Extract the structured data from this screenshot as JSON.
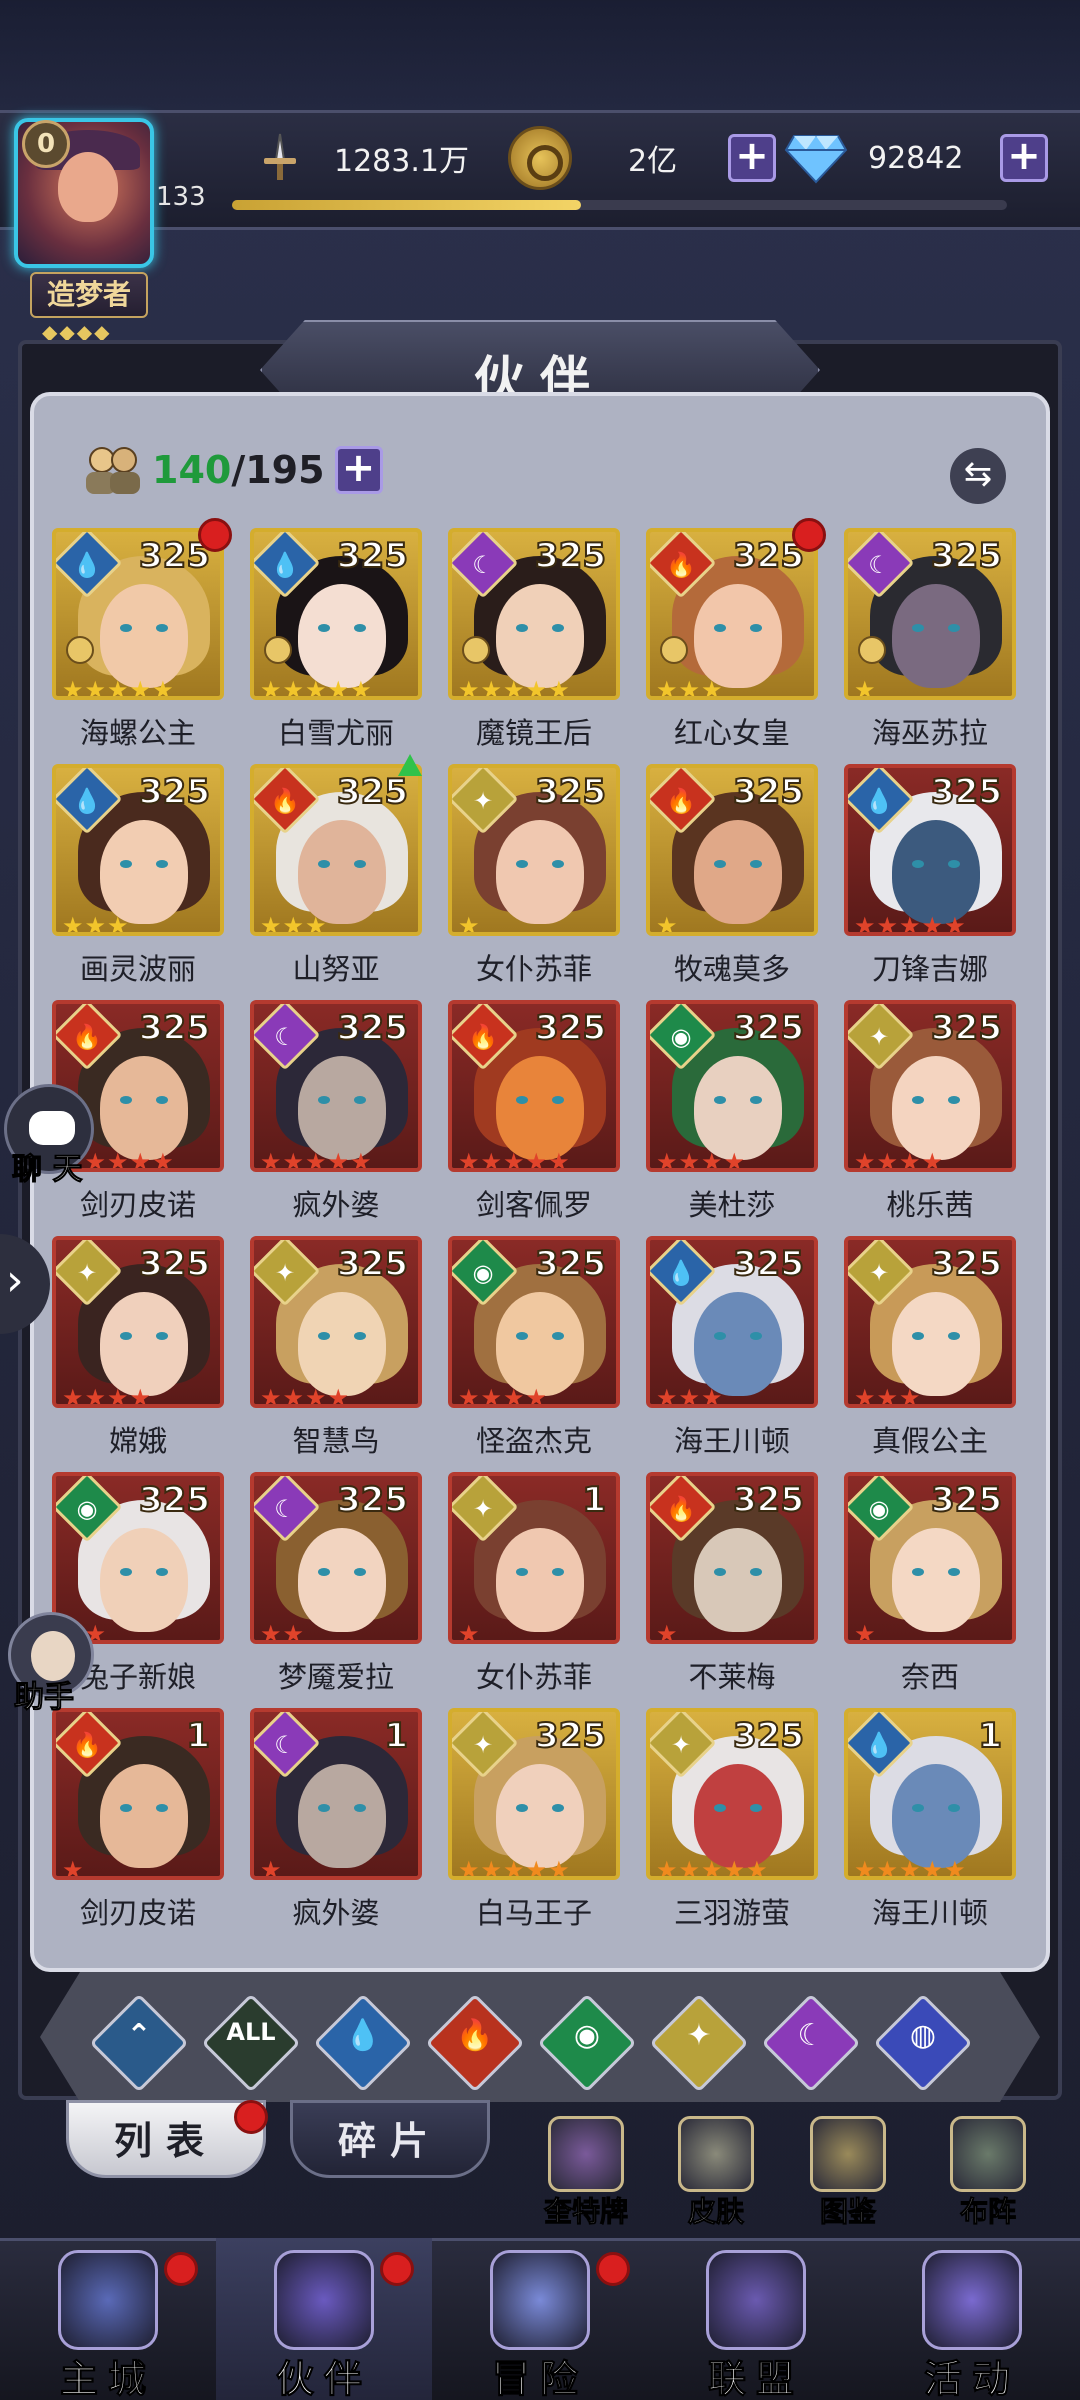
{
  "header": {
    "vip_level": "0",
    "player_level": "133",
    "title_badge": "造梦者",
    "title_stars": "◆◆◆◆",
    "xp_progress": 0.45,
    "power": "1283.1万",
    "gold": "2亿",
    "gems": "92842",
    "plus_label": "+"
  },
  "panel": {
    "title": "伙伴",
    "count_current": "140",
    "count_total": "/195",
    "add_label": "+",
    "swap_label": "⇆"
  },
  "heroes": [
    {
      "name": "海螺公主",
      "level": "325",
      "element": "water",
      "stars": 5,
      "star_color": "gold",
      "frame": "gold",
      "red_dot": true,
      "rank": true,
      "palette": [
        "#d9b35e",
        "#f1c9a8"
      ]
    },
    {
      "name": "白雪尤丽",
      "level": "325",
      "element": "water",
      "stars": 5,
      "star_color": "gold",
      "frame": "gold",
      "red_dot": false,
      "rank": true,
      "palette": [
        "#1a1416",
        "#f4ded2"
      ]
    },
    {
      "name": "魔镜王后",
      "level": "325",
      "element": "arcane",
      "stars": 5,
      "star_color": "gold",
      "frame": "gold",
      "red_dot": false,
      "rank": true,
      "palette": [
        "#2a1d1a",
        "#f0d0b8"
      ]
    },
    {
      "name": "红心女皇",
      "level": "325",
      "element": "fire",
      "stars": 3,
      "star_color": "gold",
      "frame": "gold",
      "red_dot": true,
      "rank": true,
      "palette": [
        "#b46a3a",
        "#f2c6aa"
      ]
    },
    {
      "name": "海巫苏拉",
      "level": "325",
      "element": "arcane",
      "stars": 1,
      "star_color": "gold",
      "frame": "gold",
      "red_dot": false,
      "rank": true,
      "palette": [
        "#2a2a30",
        "#7a6a80"
      ]
    },
    {
      "name": "画灵波丽",
      "level": "325",
      "element": "water",
      "stars": 3,
      "star_color": "gold",
      "frame": "gold",
      "red_dot": false,
      "rank": false,
      "palette": [
        "#4a2a1e",
        "#f2cdb2"
      ]
    },
    {
      "name": "山努亚",
      "level": "325",
      "element": "fire",
      "stars": 3,
      "star_color": "gold",
      "frame": "gold",
      "red_dot": false,
      "rank": false,
      "green_arrow": true,
      "palette": [
        "#e8e4de",
        "#e0b49a"
      ]
    },
    {
      "name": "女仆苏菲",
      "level": "325",
      "element": "light",
      "stars": 1,
      "star_color": "gold",
      "frame": "gold",
      "red_dot": false,
      "rank": false,
      "palette": [
        "#7a4030",
        "#f0c8b0"
      ]
    },
    {
      "name": "牧魂莫多",
      "level": "325",
      "element": "fire",
      "stars": 1,
      "star_color": "gold",
      "frame": "gold",
      "red_dot": false,
      "rank": false,
      "palette": [
        "#5a3420",
        "#e0a888"
      ]
    },
    {
      "name": "刀锋吉娜",
      "level": "325",
      "element": "water",
      "stars": 5,
      "star_color": "red",
      "frame": "red",
      "red_dot": false,
      "rank": false,
      "palette": [
        "#e8e8ec",
        "#3c5a7e"
      ]
    },
    {
      "name": "剑刃皮诺",
      "level": "325",
      "element": "fire",
      "stars": 5,
      "star_color": "red",
      "frame": "red",
      "red_dot": false,
      "rank": false,
      "palette": [
        "#3a2a22",
        "#e6b898"
      ]
    },
    {
      "name": "疯外婆",
      "level": "325",
      "element": "arcane",
      "stars": 5,
      "star_color": "red",
      "frame": "red",
      "red_dot": false,
      "rank": false,
      "palette": [
        "#2c2838",
        "#b8a8a0"
      ]
    },
    {
      "name": "剑客佩罗",
      "level": "325",
      "element": "fire",
      "stars": 5,
      "star_color": "red",
      "frame": "red",
      "red_dot": false,
      "rank": false,
      "palette": [
        "#a03a20",
        "#e8843a"
      ]
    },
    {
      "name": "美杜莎",
      "level": "325",
      "element": "wind",
      "stars": 4,
      "star_color": "red",
      "frame": "red",
      "red_dot": false,
      "rank": false,
      "palette": [
        "#2a6a3a",
        "#e8d0c0"
      ]
    },
    {
      "name": "桃乐茜",
      "level": "325",
      "element": "light",
      "stars": 4,
      "star_color": "red",
      "frame": "red",
      "red_dot": false,
      "rank": false,
      "palette": [
        "#9a5a3a",
        "#f4d4c0"
      ]
    },
    {
      "name": "嫦娥",
      "level": "325",
      "element": "light",
      "stars": 4,
      "star_color": "red",
      "frame": "red",
      "red_dot": false,
      "rank": false,
      "palette": [
        "#3a2420",
        "#f0d0bc"
      ]
    },
    {
      "name": "智慧鸟",
      "level": "325",
      "element": "light",
      "stars": 4,
      "star_color": "red",
      "frame": "red",
      "red_dot": false,
      "rank": false,
      "palette": [
        "#c8a060",
        "#f0d4b4"
      ]
    },
    {
      "name": "怪盗杰克",
      "level": "325",
      "element": "wind",
      "stars": 4,
      "star_color": "red",
      "frame": "red",
      "red_dot": false,
      "rank": false,
      "palette": [
        "#a07040",
        "#f0c8a0"
      ]
    },
    {
      "name": "海王川顿",
      "level": "325",
      "element": "water",
      "stars": 3,
      "star_color": "red",
      "frame": "red",
      "red_dot": false,
      "rank": false,
      "palette": [
        "#dcdce4",
        "#6a8ab8"
      ]
    },
    {
      "name": "真假公主",
      "level": "325",
      "element": "light",
      "stars": 3,
      "star_color": "red",
      "frame": "red",
      "red_dot": false,
      "rank": false,
      "palette": [
        "#c89a58",
        "#f4d8c4"
      ]
    },
    {
      "name": "兔子新娘",
      "level": "325",
      "element": "wind",
      "stars": 2,
      "star_color": "red",
      "frame": "red",
      "red_dot": false,
      "rank": false,
      "palette": [
        "#e8e4e4",
        "#f0d0b8"
      ]
    },
    {
      "name": "梦魇爱拉",
      "level": "325",
      "element": "arcane",
      "stars": 2,
      "star_color": "red",
      "frame": "red",
      "red_dot": false,
      "rank": false,
      "palette": [
        "#8a6030",
        "#f2d4c0"
      ]
    },
    {
      "name": "女仆苏菲",
      "level": "1",
      "element": "light",
      "stars": 1,
      "star_color": "red",
      "frame": "red",
      "red_dot": false,
      "rank": false,
      "palette": [
        "#7a4030",
        "#f0c8b0"
      ]
    },
    {
      "name": "不莱梅",
      "level": "325",
      "element": "fire",
      "stars": 1,
      "star_color": "red",
      "frame": "red",
      "red_dot": false,
      "rank": false,
      "palette": [
        "#5a3a28",
        "#d8c8b8"
      ]
    },
    {
      "name": "奈西",
      "level": "325",
      "element": "wind",
      "stars": 1,
      "star_color": "red",
      "frame": "red",
      "red_dot": false,
      "rank": false,
      "palette": [
        "#c8a060",
        "#f4d8c4"
      ]
    },
    {
      "name": "剑刃皮诺",
      "level": "1",
      "element": "fire",
      "stars": 1,
      "star_color": "red",
      "frame": "red",
      "red_dot": false,
      "rank": false,
      "palette": [
        "#3a2a22",
        "#e6b898"
      ]
    },
    {
      "name": "疯外婆",
      "level": "1",
      "element": "arcane",
      "stars": 1,
      "star_color": "red",
      "frame": "red",
      "red_dot": false,
      "rank": false,
      "palette": [
        "#2c2838",
        "#b8a8a0"
      ]
    },
    {
      "name": "白马王子",
      "level": "325",
      "element": "light",
      "stars": 5,
      "star_color": "orange",
      "frame": "gold",
      "red_dot": false,
      "rank": false,
      "palette": [
        "#c8a060",
        "#f0d0bc"
      ]
    },
    {
      "name": "三羽游萤",
      "level": "325",
      "element": "light",
      "stars": 5,
      "star_color": "orange",
      "frame": "gold",
      "red_dot": false,
      "rank": false,
      "palette": [
        "#e8e4e4",
        "#c04040"
      ]
    },
    {
      "name": "海王川顿",
      "level": "1",
      "element": "water",
      "stars": 5,
      "star_color": "orange",
      "frame": "gold",
      "red_dot": false,
      "rank": false,
      "palette": [
        "#dcdce4",
        "#6a8ab8"
      ]
    }
  ],
  "filters": [
    {
      "key": "default",
      "glyph": "⌃",
      "color": "#2a5a8a"
    },
    {
      "key": "all",
      "glyph": "ALL",
      "color": "#2a3c2e"
    },
    {
      "key": "water",
      "glyph": "💧",
      "color": "#2a64a8"
    },
    {
      "key": "fire",
      "glyph": "🔥",
      "color": "#b8321e"
    },
    {
      "key": "wind",
      "glyph": "◉",
      "color": "#1e8a4a"
    },
    {
      "key": "light",
      "glyph": "✦",
      "color": "#b8a23a"
    },
    {
      "key": "arcane",
      "glyph": "☾",
      "color": "#8a3ab8"
    },
    {
      "key": "planet",
      "glyph": "◍",
      "color": "#3a4ab8"
    }
  ],
  "tabs": {
    "list": "列表",
    "fragments": "碎片"
  },
  "shortcuts": [
    {
      "label": "奎特牌",
      "color": "#7a5a9a"
    },
    {
      "label": "皮肤",
      "color": "#8a8a7a"
    },
    {
      "label": "图鉴",
      "color": "#9a8a5a"
    },
    {
      "label": "布阵",
      "color": "#6a7a6a"
    }
  ],
  "side": {
    "chat_label": "聊 天",
    "helper_label": "助手",
    "arrow": "›"
  },
  "nav": [
    {
      "label": "主城",
      "red_dot": true,
      "active": false,
      "color": "#5a6ab8"
    },
    {
      "label": "伙伴",
      "red_dot": true,
      "active": true,
      "color": "#6a5ac0"
    },
    {
      "label": "冒险",
      "red_dot": true,
      "active": false,
      "color": "#7a8ad8"
    },
    {
      "label": "联盟",
      "red_dot": false,
      "active": false,
      "color": "#6a5ab0"
    },
    {
      "label": "活动",
      "red_dot": false,
      "active": false,
      "color": "#7a6ad0"
    }
  ],
  "colors": {
    "gold_frame": "#d4ad2d",
    "red_frame": "#b53a2f",
    "star_gold": "#f2c52b",
    "star_red": "#e0432a",
    "star_orange": "#f08a1e"
  }
}
